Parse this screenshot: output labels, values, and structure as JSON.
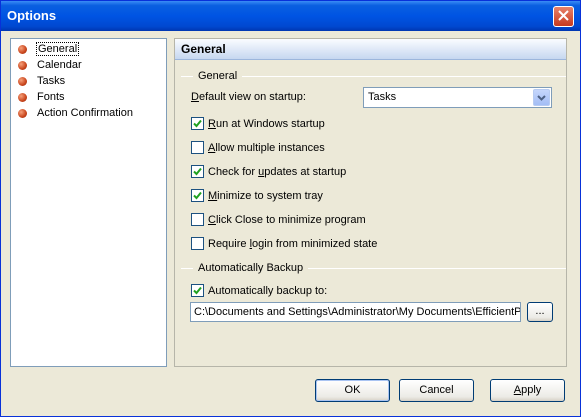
{
  "window": {
    "title": "Options"
  },
  "nav": {
    "items": [
      {
        "label": "General",
        "selected": true
      },
      {
        "label": "Calendar"
      },
      {
        "label": "Tasks"
      },
      {
        "label": "Fonts"
      },
      {
        "label": "Action Confirmation"
      }
    ]
  },
  "panel": {
    "header": "General",
    "general_group": {
      "title": "General",
      "default_view_label_pre": "D",
      "default_view_label_post": "efault view on startup:",
      "default_view_value": "Tasks",
      "options": [
        {
          "pre": "",
          "ul": "R",
          "post": "un at Windows startup",
          "checked": true
        },
        {
          "pre": "",
          "ul": "A",
          "post": "llow multiple instances",
          "checked": false
        },
        {
          "pre": "Check for ",
          "ul": "u",
          "post": "pdates at startup",
          "checked": true
        },
        {
          "pre": "",
          "ul": "M",
          "post": "inimize to system tray",
          "checked": true
        },
        {
          "pre": "",
          "ul": "C",
          "post": "lick Close to minimize program",
          "checked": false
        },
        {
          "pre": "Require ",
          "ul": "l",
          "post": "ogin from minimized state",
          "checked": false
        }
      ]
    },
    "backup_group": {
      "title": "Automatically Backup",
      "checkbox_label": "Automatically backup to:",
      "checked": true,
      "path": "C:\\Documents and Settings\\Administrator\\My Documents\\EfficientP",
      "browse_label": "..."
    }
  },
  "buttons": {
    "ok": "OK",
    "cancel": "Cancel",
    "apply_ul": "A",
    "apply_post": "pply"
  },
  "colors": {
    "titlebar": "#0054e3",
    "face": "#ece9d8",
    "check": "#21a121"
  }
}
